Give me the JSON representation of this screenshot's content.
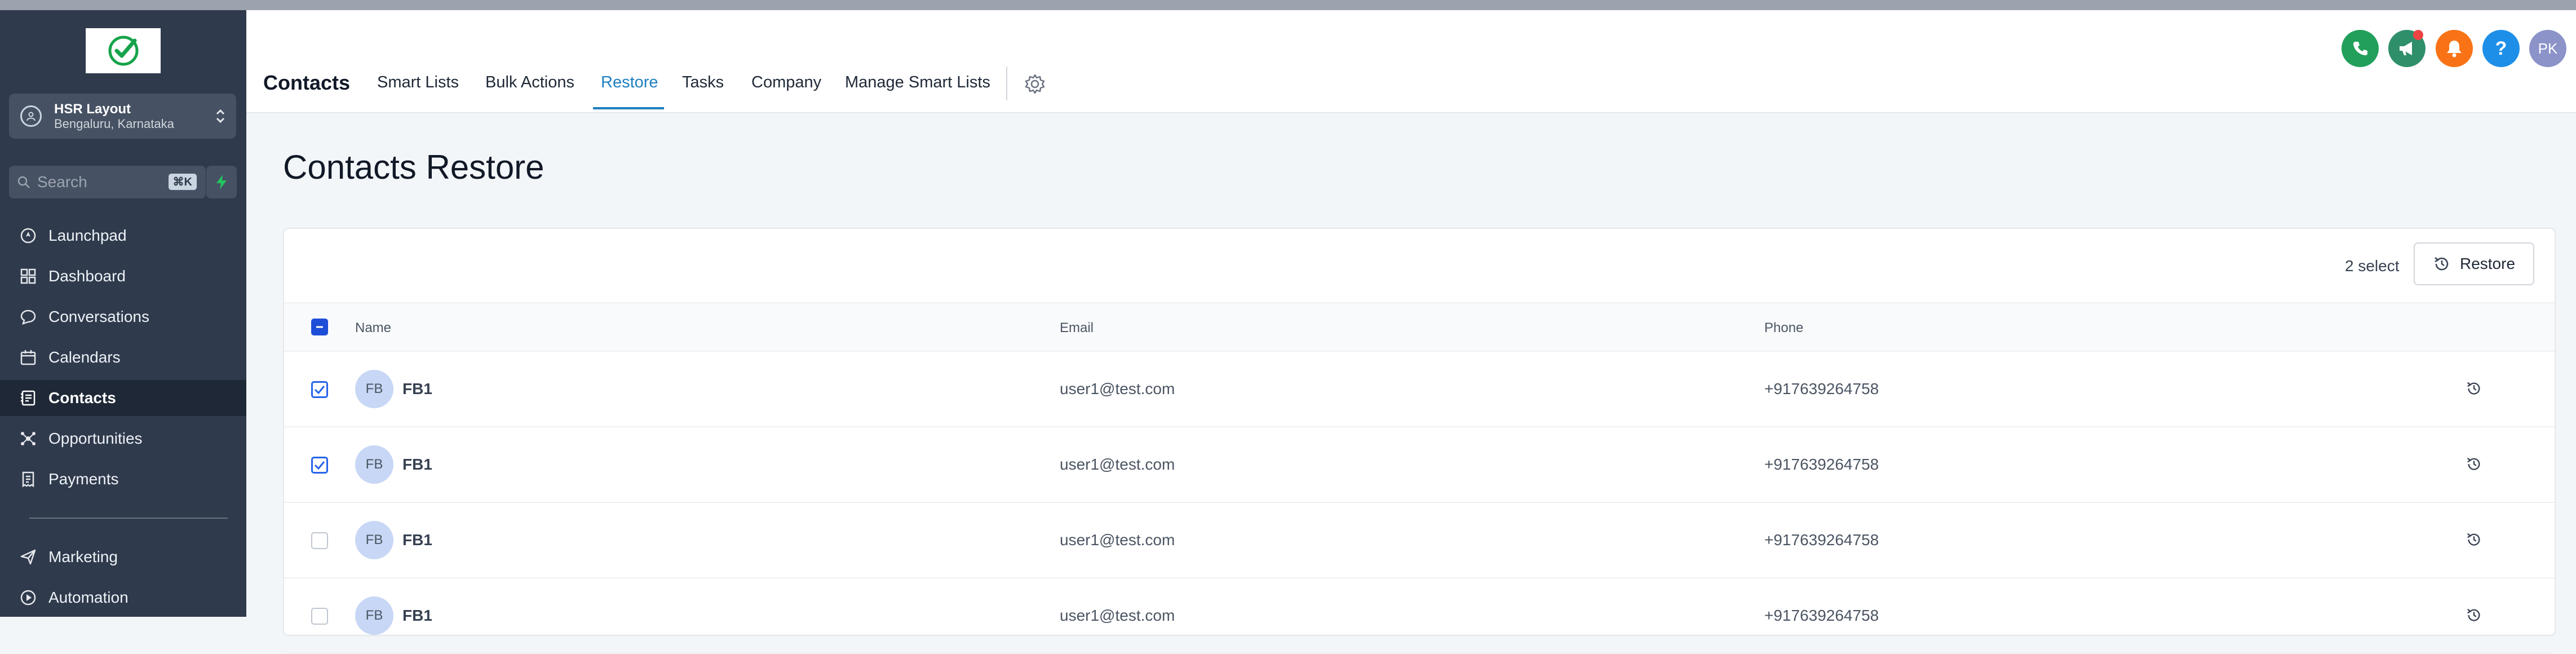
{
  "sidebar": {
    "location": {
      "name": "HSR Layout",
      "sub": "Bengaluru, Karnataka"
    },
    "search": {
      "placeholder": "Search",
      "shortcut": "⌘K"
    },
    "items": [
      {
        "label": "Launchpad",
        "icon": "launchpad-icon",
        "active": false
      },
      {
        "label": "Dashboard",
        "icon": "dashboard-icon",
        "active": false
      },
      {
        "label": "Conversations",
        "icon": "chat-icon",
        "active": false
      },
      {
        "label": "Calendars",
        "icon": "calendar-icon",
        "active": false
      },
      {
        "label": "Contacts",
        "icon": "contacts-icon",
        "active": true
      },
      {
        "label": "Opportunities",
        "icon": "opportunities-icon",
        "active": false
      },
      {
        "label": "Payments",
        "icon": "payments-icon",
        "active": false
      }
    ],
    "items2": [
      {
        "label": "Marketing",
        "icon": "send-icon"
      },
      {
        "label": "Automation",
        "icon": "automation-icon"
      }
    ]
  },
  "header": {
    "brand": "Contacts",
    "tabs": [
      {
        "label": "Smart Lists",
        "active": false
      },
      {
        "label": "Bulk Actions",
        "active": false
      },
      {
        "label": "Restore",
        "active": true
      },
      {
        "label": "Tasks",
        "active": false
      },
      {
        "label": "Company",
        "active": false
      },
      {
        "label": "Manage Smart Lists",
        "active": false
      }
    ],
    "actions": {
      "help_label": "?",
      "user_initials": "PK",
      "colors": {
        "phone": "#22a05b",
        "announce": "#2f8f6b",
        "bell": "#f97316",
        "help": "#1d8fe8",
        "avatar": "#8b93c9"
      }
    }
  },
  "main": {
    "title": "Contacts Restore",
    "selection_label": "2 select",
    "restore_label": "Restore",
    "columns": [
      "Name",
      "Email",
      "Phone"
    ],
    "rows": [
      {
        "initials": "FB",
        "name": "FB1",
        "email": "user1@test.com",
        "phone": "+917639264758",
        "checked": true
      },
      {
        "initials": "FB",
        "name": "FB1",
        "email": "user1@test.com",
        "phone": "+917639264758",
        "checked": true
      },
      {
        "initials": "FB",
        "name": "FB1",
        "email": "user1@test.com",
        "phone": "+917639264758",
        "checked": false
      },
      {
        "initials": "FB",
        "name": "FB1",
        "email": "user1@test.com",
        "phone": "+917639264758",
        "checked": false
      }
    ]
  },
  "colors": {
    "accent": "#1d7fbf",
    "sidebar": "#2f3a4c",
    "checkbox": "#2563eb",
    "logo_check": "#16a34a"
  }
}
